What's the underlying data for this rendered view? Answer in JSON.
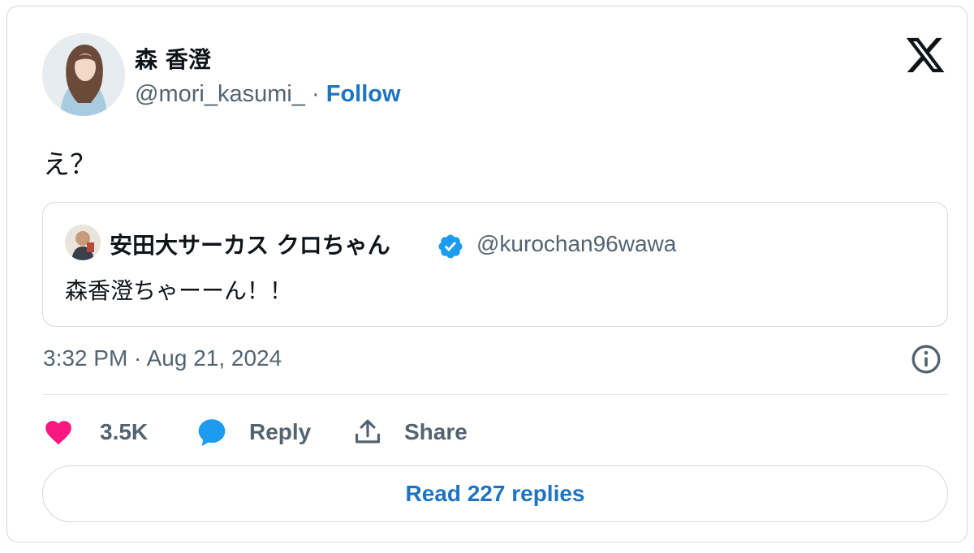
{
  "author": {
    "name": "森 香澄",
    "handle": "@mori_kasumi_",
    "separator": "·",
    "follow_label": "Follow"
  },
  "tweet": {
    "text": "え？",
    "timestamp": "3:32 PM · Aug 21, 2024"
  },
  "quoted": {
    "name": "安田大サーカス クロちゃん",
    "handle": "@kurochan96wawa",
    "text": "森香澄ちゃーーん！！",
    "verified_color": "#1d9bf0"
  },
  "actions": {
    "likes_count": "3.5K",
    "reply_label": "Reply",
    "share_label": "Share"
  },
  "read_replies_label": "Read 227 replies",
  "icons": {
    "brand": "x-logo-icon",
    "like": "heart-icon",
    "reply": "speech-bubble-icon",
    "share": "share-upload-icon",
    "info": "info-icon",
    "verified": "verified-badge-icon"
  },
  "colors": {
    "like": "#f91880",
    "reply": "#1d9bf0",
    "link": "#1d74c3",
    "muted": "#536471",
    "border": "#cfd9de"
  }
}
